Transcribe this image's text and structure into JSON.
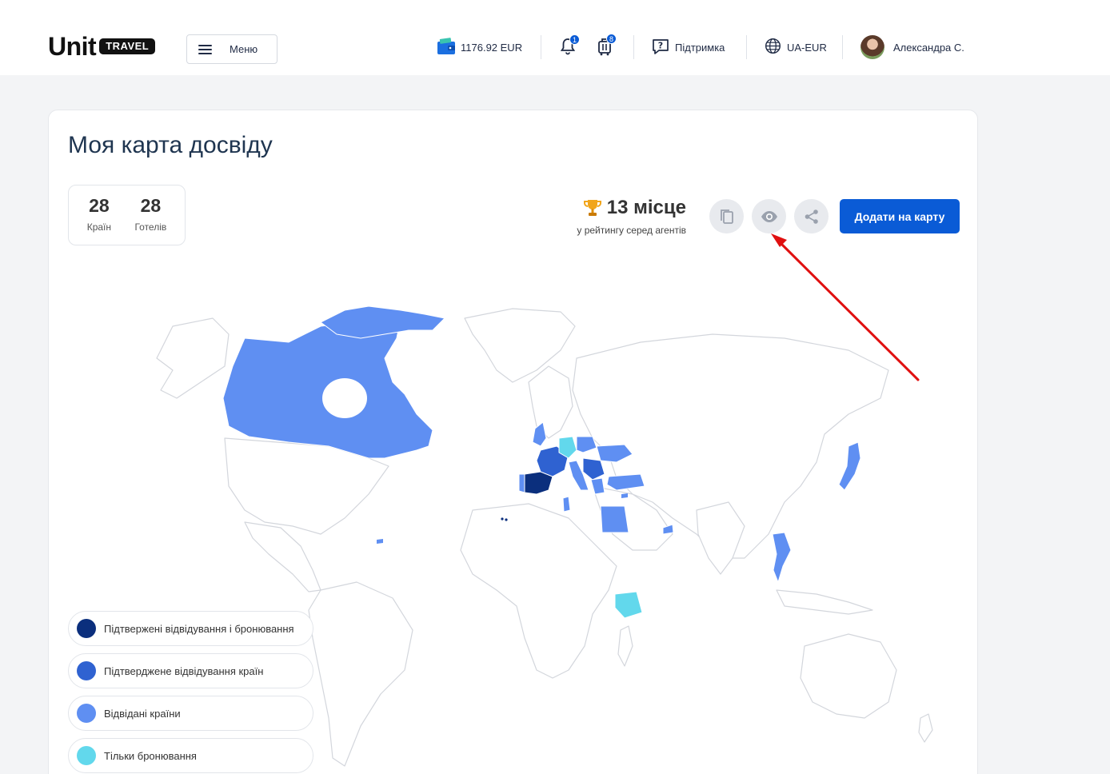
{
  "header": {
    "logo_unit": "Unit",
    "logo_travel": "TRAVEL",
    "menu_label": "Меню",
    "balance": "1176.92 EUR",
    "notifications_count": "1",
    "bookings_count": "8",
    "support_label": "Підтримка",
    "locale_label": "UA-EUR",
    "user_name": "Александра С."
  },
  "page": {
    "title": "Моя карта досвіду",
    "stats": [
      {
        "value": "28",
        "label": "Країн"
      },
      {
        "value": "28",
        "label": "Готелів"
      }
    ],
    "rank_place": "13 місце",
    "rank_sub": "у рейтингу серед агентів",
    "add_button": "Додати на карту"
  },
  "colors": {
    "confirmed_visits_bookings": "#0b2f7d",
    "confirmed_visits": "#2f62d1",
    "visited": "#5f8ff2",
    "bookings_only": "#62d8ec",
    "accent": "#0a5bd6",
    "annotation_arrow": "#e01010"
  },
  "legend": [
    {
      "label": "Підтвержені відвідування і бронювання",
      "color": "#0b2f7d"
    },
    {
      "label": "Підтверджене відвідування країн",
      "color": "#2f62d1"
    },
    {
      "label": "Відвідані країни",
      "color": "#5f8ff2"
    },
    {
      "label": "Тільки бронювання",
      "color": "#62d8ec"
    }
  ],
  "icons": {
    "wallet": "wallet-icon",
    "bell": "bell-icon",
    "luggage": "luggage-icon",
    "support": "support-icon",
    "globe": "globe-icon",
    "copy": "copy-icon",
    "eye": "eye-icon",
    "share": "share-icon",
    "trophy": "trophy-icon"
  }
}
